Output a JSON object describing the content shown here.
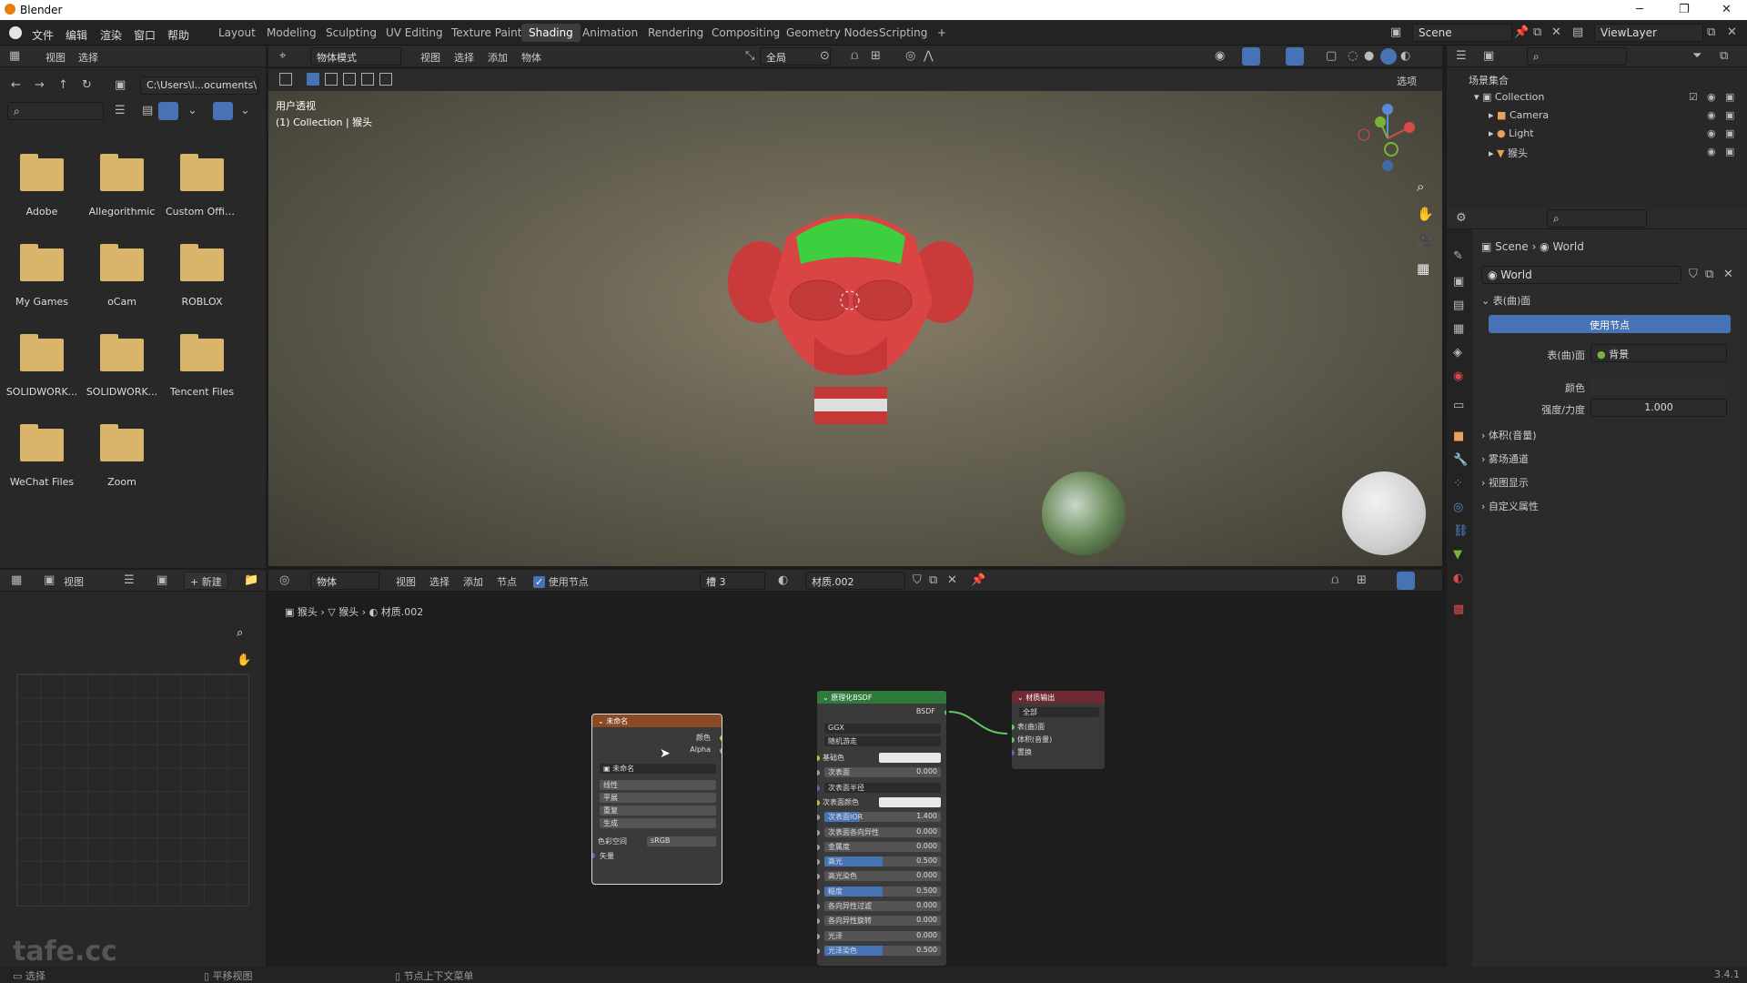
{
  "window": {
    "title": "Blender",
    "minimize": "─",
    "maximize": "❐",
    "close": "✕"
  },
  "menus": [
    "文件",
    "编辑",
    "渲染",
    "窗口",
    "帮助"
  ],
  "workspaces": [
    "Layout",
    "Modeling",
    "Sculpting",
    "UV Editing",
    "Texture Paint",
    "Shading",
    "Animation",
    "Rendering",
    "Compositing",
    "Geometry Nodes",
    "Scripting",
    "+"
  ],
  "active_workspace": "Shading",
  "scene": {
    "name": "Scene",
    "view_layer": "ViewLayer"
  },
  "filebrowser": {
    "header_items": [
      "视图",
      "选择"
    ],
    "path": "C:\\Users\\l...ocuments\\",
    "folders": [
      "Adobe",
      "Allegorithmic",
      "Custom Offic...",
      "My Games",
      "oCam",
      "ROBLOX",
      "SOLIDWORK...",
      "SOLIDWORK...",
      "Tencent Files",
      "WeChat Files",
      "Zoom"
    ]
  },
  "viewport": {
    "mode": "物体模式",
    "header_items": [
      "视图",
      "选择",
      "添加",
      "物体"
    ],
    "transform": "全局",
    "options": "选项",
    "overlay_title": "用户透视",
    "overlay_subtitle": "(1) Collection | 猴头"
  },
  "outliner": {
    "root": "场景集合",
    "items": [
      {
        "name": "Collection",
        "indent": 1
      },
      {
        "name": "Camera",
        "indent": 2
      },
      {
        "name": "Light",
        "indent": 2
      },
      {
        "name": "猴头",
        "indent": 2
      }
    ]
  },
  "properties": {
    "breadcrumb": [
      "Scene",
      "World"
    ],
    "world_name": "World",
    "surface_panel": "表(曲)面",
    "use_nodes_button": "使用节点",
    "surface_label": "表(曲)面",
    "surface_value": "背景",
    "color_label": "颜色",
    "strength_label": "强度/力度",
    "strength_value": "1.000",
    "collapsed_panels": [
      "体积(音量)",
      "雾场通道",
      "视图显示",
      "自定义属性"
    ]
  },
  "image_editor": {
    "header_view": "视图",
    "new_button": "新建"
  },
  "node_editor": {
    "object_mode": "物体",
    "header_items": [
      "视图",
      "选择",
      "添加",
      "节点"
    ],
    "use_nodes": "使用节点",
    "slot": "槽 3",
    "material": "材质.002",
    "breadcrumb": [
      "猴头",
      "猴头",
      "材质.002"
    ],
    "image_node": {
      "title": "未命名",
      "outputs": [
        "颜色",
        "Alpha"
      ],
      "image_name": "未命名",
      "interpolation": "线性",
      "projection": "平展",
      "extension": "重复",
      "source": "生成",
      "colorspace_label": "色彩空间",
      "colorspace_value": "sRGB",
      "vector_label": "矢量"
    },
    "bsdf_node": {
      "title": "原理化BSDF",
      "output": "BSDF",
      "distribution": "GGX",
      "subsurface_method": "随机游走",
      "rows": [
        {
          "label": "基础色",
          "value": "",
          "kind": "color"
        },
        {
          "label": "次表面",
          "value": "0.000",
          "kind": "num"
        },
        {
          "label": "次表面半径",
          "value": "",
          "kind": "menu"
        },
        {
          "label": "次表面颜色",
          "value": "",
          "kind": "color"
        },
        {
          "label": "次表面IOR",
          "value": "1.400",
          "kind": "bar",
          "fill": 0.3
        },
        {
          "label": "次表面各向异性",
          "value": "0.000",
          "kind": "num"
        },
        {
          "label": "金属度",
          "value": "0.000",
          "kind": "num"
        },
        {
          "label": "高光",
          "value": "0.500",
          "kind": "bar",
          "fill": 0.5
        },
        {
          "label": "高光染色",
          "value": "0.000",
          "kind": "num"
        },
        {
          "label": "糙度",
          "value": "0.500",
          "kind": "bar",
          "fill": 0.5
        },
        {
          "label": "各向异性过滤",
          "value": "0.000",
          "kind": "num"
        },
        {
          "label": "各向异性旋转",
          "value": "0.000",
          "kind": "num"
        },
        {
          "label": "光泽",
          "value": "0.000",
          "kind": "num"
        },
        {
          "label": "光泽染色",
          "value": "0.500",
          "kind": "bar",
          "fill": 0.5
        }
      ]
    },
    "output_node": {
      "title": "材质输出",
      "target": "全部",
      "inputs": [
        "表(曲)面",
        "体积(音量)",
        "置换"
      ]
    }
  },
  "statusbar": {
    "select": "选择",
    "pan": "平移视图",
    "context_menu": "节点上下文菜单",
    "version": "3.4.1"
  },
  "watermark": "tafe.cc",
  "colors": {
    "accent": "#4772b3",
    "bsdf_header": "#2f7a3a",
    "image_header": "#8a4a26",
    "output_header": "#6e2a33"
  }
}
